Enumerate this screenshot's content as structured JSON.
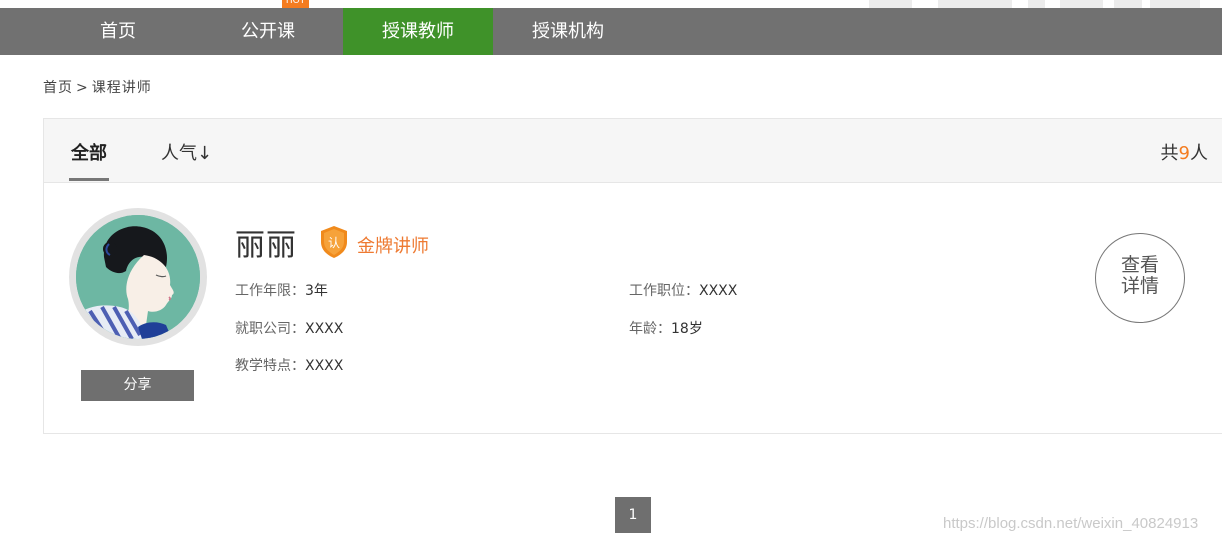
{
  "nav": {
    "items": [
      {
        "label": "首页"
      },
      {
        "label": "公开课"
      },
      {
        "label": "授课教师"
      },
      {
        "label": "授课机构"
      }
    ],
    "active_index": 2,
    "hot_badge": "HOT",
    "active_color": "#3f9229",
    "bar_color": "#717171"
  },
  "breadcrumb": {
    "home": "首页",
    "separator": ">",
    "current": "课程讲师"
  },
  "filters": {
    "tabs": [
      {
        "label": "全部"
      },
      {
        "label": "人气↓"
      }
    ],
    "total_prefix": "共",
    "total_count": "9",
    "total_suffix": "人"
  },
  "teacher": {
    "name": "丽丽",
    "badge_icon": "认",
    "badge_label": "金牌讲师",
    "share_label": "分享",
    "fields": {
      "work_years_label": "工作年限：",
      "work_years_value": "3年",
      "position_label": "工作职位：",
      "position_value": "XXXX",
      "company_label": "就职公司：",
      "company_value": "XXXX",
      "age_label": "年龄：",
      "age_value": "18岁",
      "teaching_label": "教学特点：",
      "teaching_value": "XXXX"
    },
    "detail_line1": "查看",
    "detail_line2": "详情"
  },
  "pagination": {
    "current": "1"
  },
  "watermark": "https://blog.csdn.net/weixin_40824913",
  "colors": {
    "accent_orange": "#f47c20",
    "gold_text": "#ee7a32",
    "button_gray": "#6f6f6f"
  }
}
